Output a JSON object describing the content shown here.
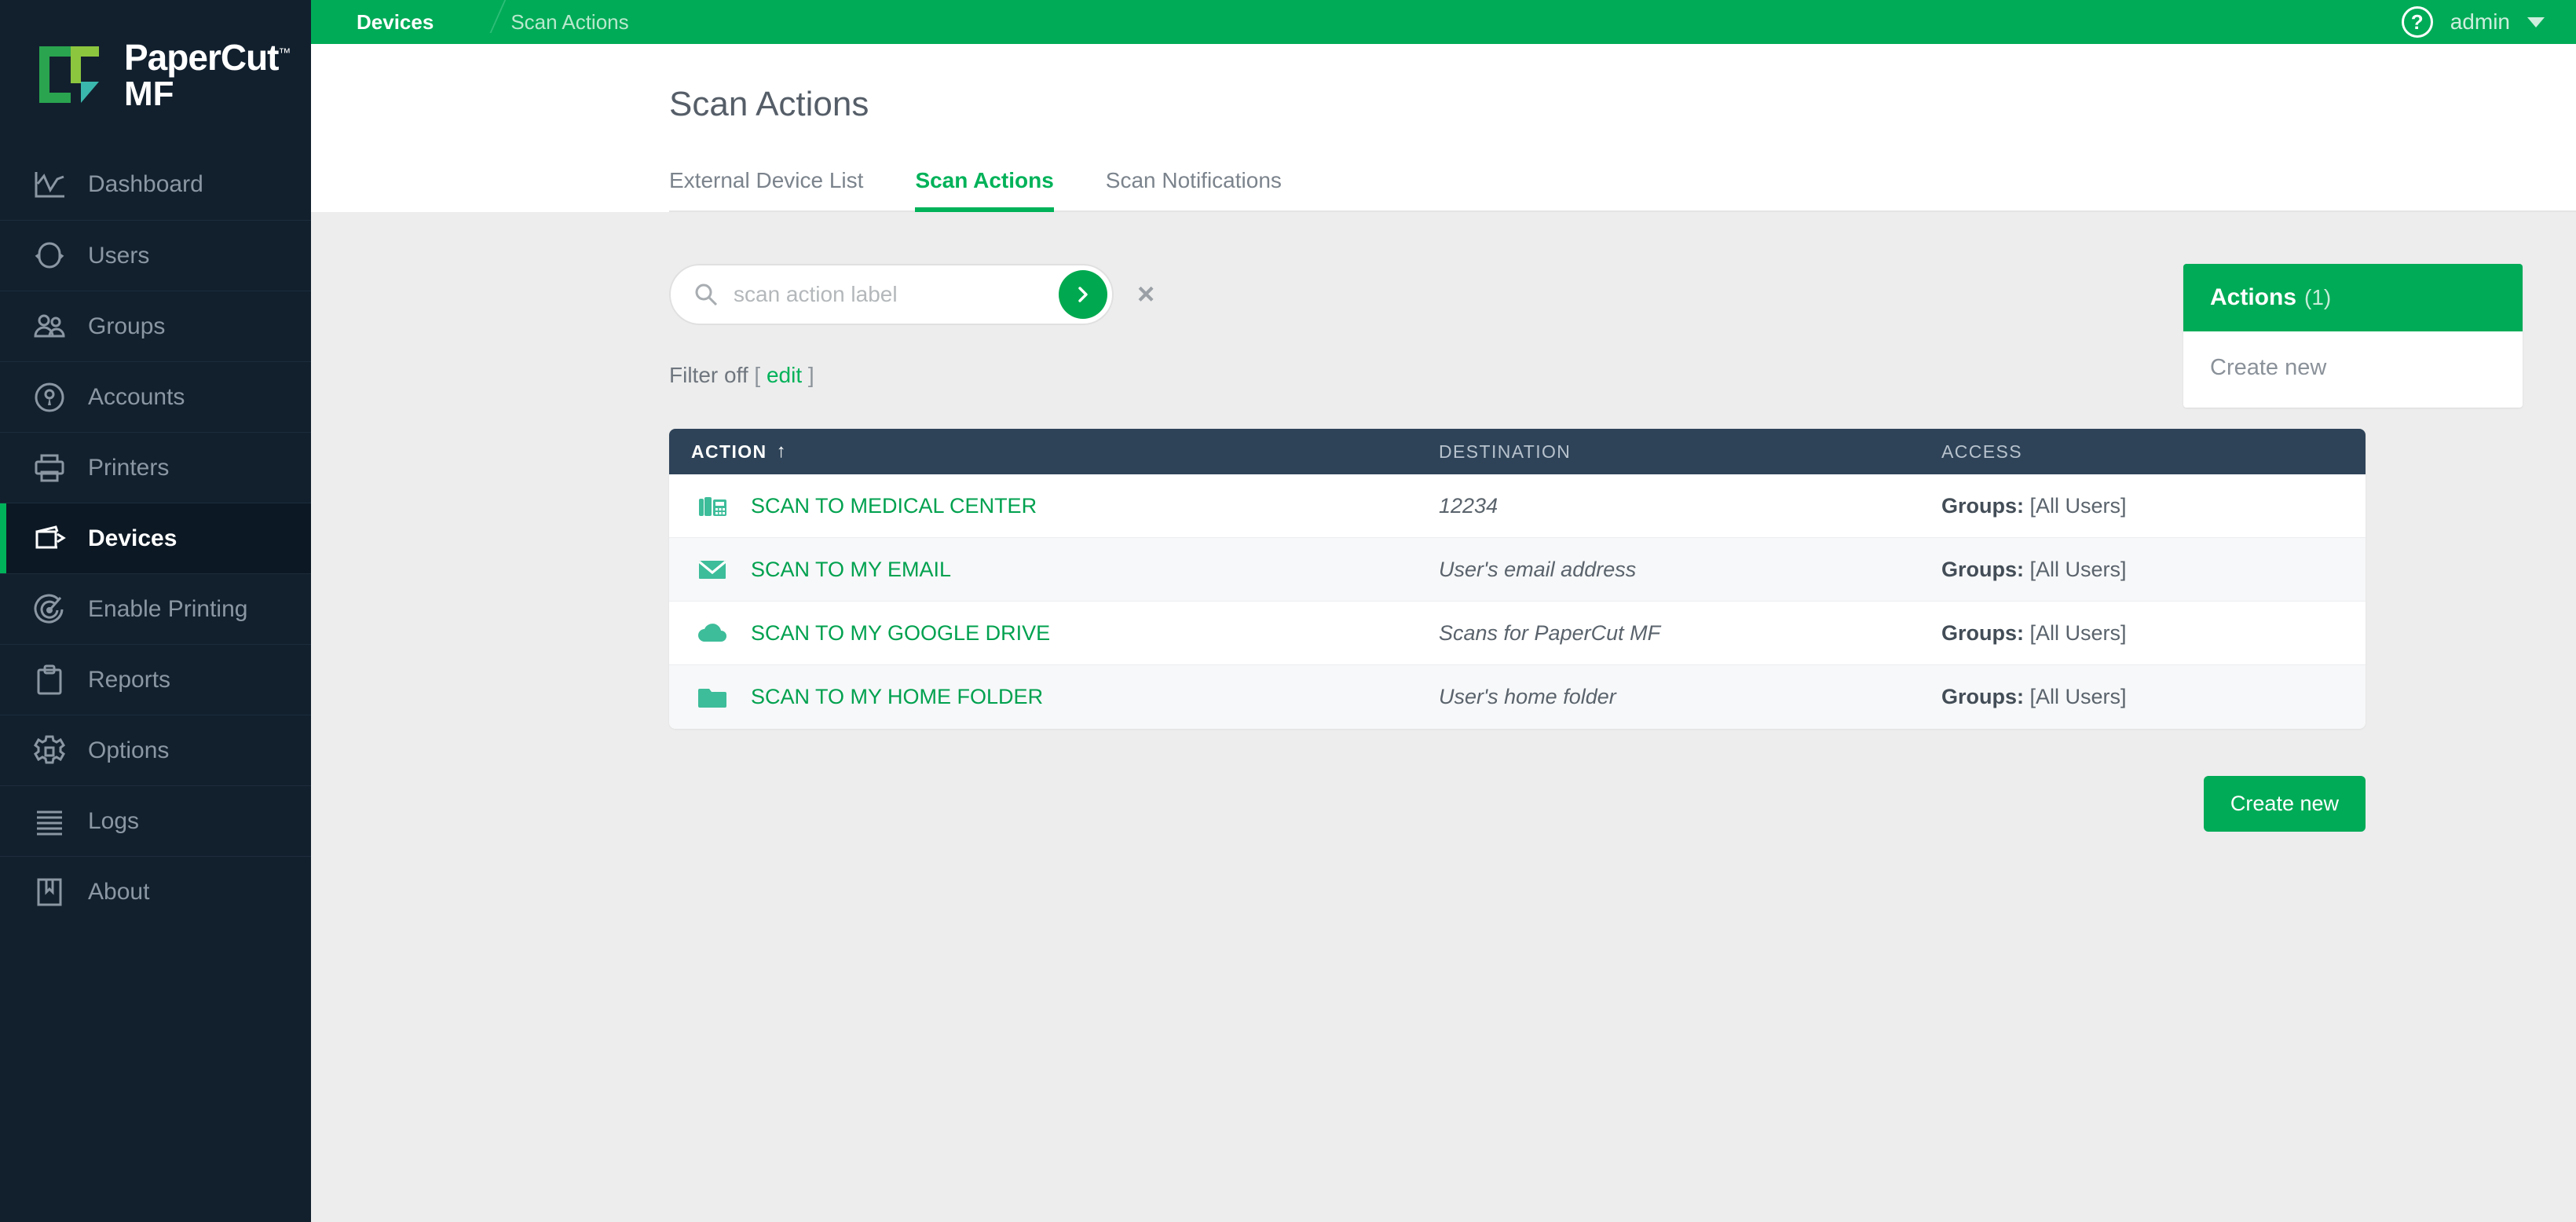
{
  "brand": {
    "name": "PaperCut",
    "tm": "™",
    "sub": "MF",
    "logo_green": "#2aa44f",
    "logo_lime": "#8cc63e",
    "logo_teal": "#3ab7ad"
  },
  "topbar": {
    "breadcrumb": [
      {
        "label": "Devices",
        "active": true
      },
      {
        "label": "Scan Actions",
        "active": false
      }
    ],
    "help_icon": "help-circle-icon",
    "user": "admin",
    "chevron_icon": "chevron-down-icon",
    "bg_color": "#00ab57"
  },
  "sidebar": {
    "items": [
      {
        "label": "Dashboard",
        "icon": "chart-line-icon",
        "active": false
      },
      {
        "label": "Users",
        "icon": "user-head-icon",
        "active": false
      },
      {
        "label": "Groups",
        "icon": "users-group-icon",
        "active": false
      },
      {
        "label": "Accounts",
        "icon": "lock-circle-icon",
        "active": false
      },
      {
        "label": "Printers",
        "icon": "printer-icon",
        "active": false
      },
      {
        "label": "Devices",
        "icon": "device-copier-icon",
        "active": true
      },
      {
        "label": "Enable Printing",
        "icon": "power-radar-icon",
        "active": false
      },
      {
        "label": "Reports",
        "icon": "clipboard-icon",
        "active": false
      },
      {
        "label": "Options",
        "icon": "gear-icon",
        "active": false
      },
      {
        "label": "Logs",
        "icon": "lines-list-icon",
        "active": false
      },
      {
        "label": "About",
        "icon": "book-bookmark-icon",
        "active": false
      }
    ],
    "bg_color": "#12202e",
    "active_marker_color": "#00b259"
  },
  "page": {
    "title": "Scan Actions",
    "tabs": [
      {
        "label": "External Device List",
        "active": false
      },
      {
        "label": "Scan Actions",
        "active": true
      },
      {
        "label": "Scan Notifications",
        "active": false
      }
    ],
    "accent_color": "#00b259"
  },
  "search": {
    "placeholder": "scan action label",
    "value": "",
    "search_icon": "search-icon",
    "submit_icon": "chevron-right-icon",
    "clear_icon": "close-x-icon"
  },
  "filter": {
    "status_text": "Filter off",
    "bracket_open": "[",
    "edit_label": "edit",
    "bracket_close": "]"
  },
  "table": {
    "columns": [
      {
        "label": "ACTION",
        "sorted": true,
        "sort_icon": "sort-asc-arrow"
      },
      {
        "label": "DESTINATION",
        "sorted": false
      },
      {
        "label": "ACCESS",
        "sorted": false
      }
    ],
    "sort_arrow": "↑",
    "rows": [
      {
        "icon": "fax-machine-icon",
        "action": "SCAN TO MEDICAL CENTER",
        "destination": "12234",
        "access_label": "Groups:",
        "access_value": "[All Users]"
      },
      {
        "icon": "envelope-icon",
        "action": "SCAN TO MY EMAIL",
        "destination": "User's email address",
        "access_label": "Groups:",
        "access_value": "[All Users]"
      },
      {
        "icon": "cloud-icon",
        "action": "SCAN TO MY GOOGLE DRIVE",
        "destination": "Scans for PaperCut MF",
        "access_label": "Groups:",
        "access_value": "[All Users]"
      },
      {
        "icon": "folder-icon",
        "action": "SCAN TO MY HOME FOLDER",
        "destination": "User's home folder",
        "access_label": "Groups:",
        "access_value": "[All Users]"
      }
    ],
    "header_bg": "#2e4358",
    "link_color": "#00a14f",
    "icon_color": "#3dbd9a"
  },
  "create_button": {
    "label": "Create new"
  },
  "actions_panel": {
    "title": "Actions",
    "count": "(1)",
    "links": [
      {
        "label": "Create new"
      }
    ]
  }
}
